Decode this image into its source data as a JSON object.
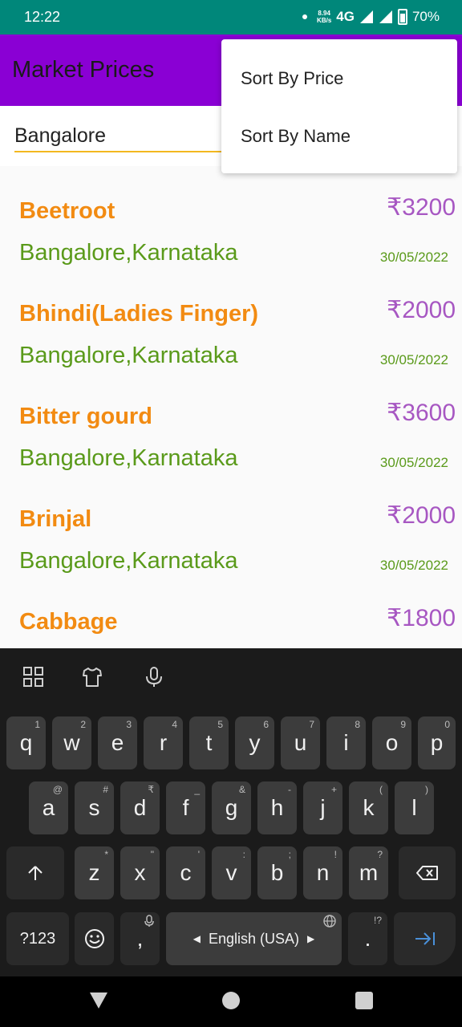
{
  "status_bar": {
    "time": "12:22",
    "speed_value": "8.94",
    "speed_unit": "KB/s",
    "network": "4G",
    "battery": "70%"
  },
  "app_bar": {
    "title": "Market Prices"
  },
  "search": {
    "value": "Bangalore"
  },
  "menu": {
    "items": [
      "Sort By Price",
      "Sort By Name"
    ]
  },
  "list": {
    "items": [
      {
        "name": "Beetroot",
        "price": "₹3200",
        "location": "Bangalore,Karnataka",
        "date": "30/05/2022"
      },
      {
        "name": "Bhindi(Ladies Finger)",
        "price": "₹2000",
        "location": "Bangalore,Karnataka",
        "date": "30/05/2022"
      },
      {
        "name": "Bitter gourd",
        "price": "₹3600",
        "location": "Bangalore,Karnataka",
        "date": "30/05/2022"
      },
      {
        "name": "Brinjal",
        "price": "₹2000",
        "location": "Bangalore,Karnataka",
        "date": "30/05/2022"
      },
      {
        "name": "Cabbage",
        "price": "₹1800",
        "location": "",
        "date": ""
      }
    ]
  },
  "keyboard": {
    "row1": {
      "keys": [
        "q",
        "w",
        "e",
        "r",
        "t",
        "y",
        "u",
        "i",
        "o",
        "p"
      ],
      "hints": [
        "1",
        "2",
        "3",
        "4",
        "5",
        "6",
        "7",
        "8",
        "9",
        "0"
      ]
    },
    "row2": {
      "keys": [
        "a",
        "s",
        "d",
        "f",
        "g",
        "h",
        "j",
        "k",
        "l"
      ],
      "hints": [
        "@",
        "#",
        "₹",
        "_",
        "&",
        "-",
        "+",
        "(",
        ")"
      ]
    },
    "row3": {
      "keys": [
        "z",
        "x",
        "c",
        "v",
        "b",
        "n",
        "m"
      ],
      "hints": [
        "*",
        "\"",
        "'",
        ":",
        ";",
        "!",
        "?"
      ]
    },
    "symbols_label": "?123",
    "comma": ",",
    "space_label": "English (USA)",
    "period": ".",
    "period_hint": "!?"
  },
  "colors": {
    "status_bar": "#00877a",
    "app_bar": "#8a00d4",
    "item_name": "#f28b12",
    "item_price": "#a757c2",
    "item_location": "#5a9a1a",
    "search_underline": "#f3b81f"
  }
}
